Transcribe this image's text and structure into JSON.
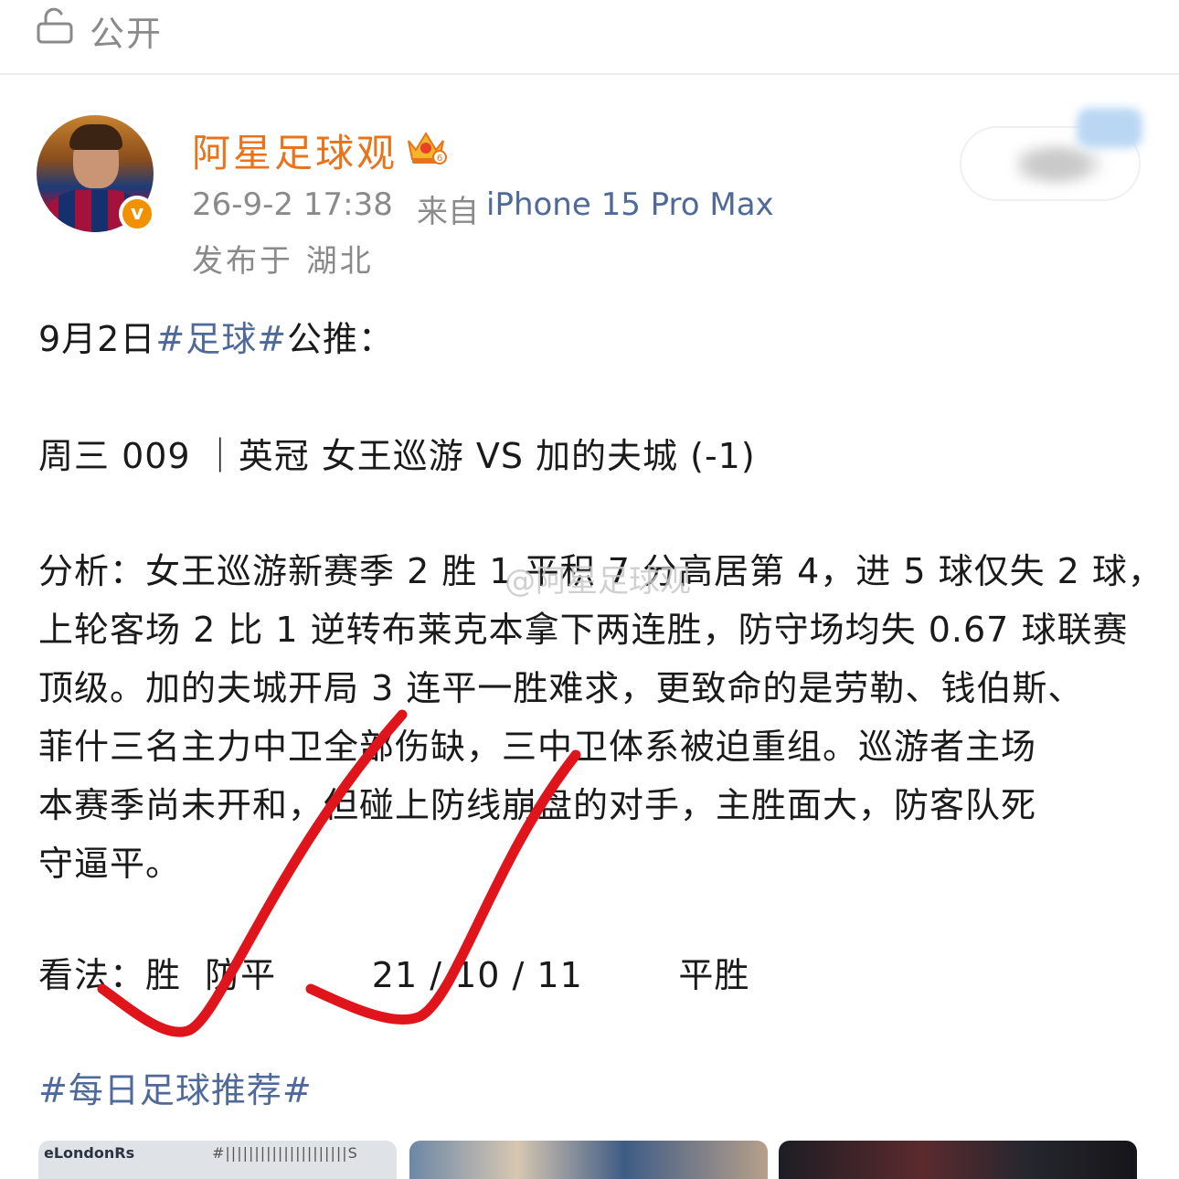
{
  "header": {
    "visibility_label": "公开",
    "icon": "lock-open-icon"
  },
  "post": {
    "author": {
      "name": "阿星足球观",
      "badge_icon": "crown-icon",
      "verified_icon": "verified-v-icon"
    },
    "timestamp": "26-9-2 17:38",
    "source_prefix": "来自",
    "device": "iPhone 15 Pro Max",
    "location": "发布于 湖北",
    "body": {
      "line1_prefix": "9月2日",
      "line1_tag": "#足球#",
      "line1_suffix": "公推：",
      "match": "周三 009 ｜英冠 女王巡游 VS 加的夫城 (-1)",
      "analysis_lines": [
        "分析：女王巡游新赛季 2 胜 1 平积 7 分高居第 4，进 5 球仅失 2 球，",
        "上轮客场 2 比 1 逆转布莱克本拿下两连胜，防守场均失 0.67 球联赛",
        "顶级。加的夫城开局 3 连平一胜难求，更致命的是劳勒、钱伯斯、",
        "菲什三名主力中卫全部伤缺，三中卫体系被迫重组。巡游者主场",
        "本赛季尚未开和，但碰上防线崩盘的对手，主胜面大，防客队死",
        "守逼平。"
      ],
      "opinion": "看法：胜  防平        21 / 10 / 11        平胜",
      "footer_tag": "#每日足球推荐#"
    },
    "watermark": "@阿星足球观"
  },
  "thumbnails": {
    "first_label": "eLondonRs",
    "first_code": "#|||||||||||||||||||||S"
  },
  "colors": {
    "username": "#e8731b",
    "hashtag": "#4f6a99",
    "checkmark": "#e0141b",
    "muted": "#8a8a8a"
  }
}
